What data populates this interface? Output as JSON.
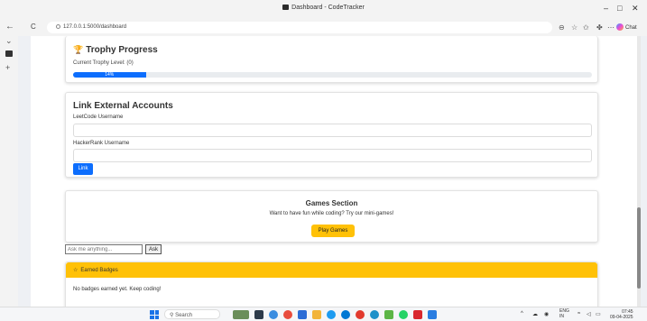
{
  "window": {
    "title": "Dashboard - CodeTracker",
    "minimize": "–",
    "maximize": "□",
    "close": "✕"
  },
  "browser": {
    "back": "←",
    "reload": "C",
    "url": "127.0.0.1:5000/dashboard",
    "chat_label": "Chat"
  },
  "trophy": {
    "title": "Trophy Progress",
    "current_level_text": "Current Trophy Level: (0)",
    "progress_label": "14%",
    "progress_fraction": 0.14
  },
  "link_accounts": {
    "title": "Link External Accounts",
    "leetcode_label": "LeetCode Username",
    "leetcode_value": "",
    "hackerrank_label": "HackerRank Username",
    "hackerrank_value": "",
    "button_label": "Link"
  },
  "games": {
    "title": "Games Section",
    "subtitle": "Want to have fun while coding? Try our mini-games!",
    "button_label": "Play Games"
  },
  "ask": {
    "placeholder": "Ask me anything...",
    "button_label": "Ask"
  },
  "badges": {
    "header": "Earned Badges",
    "body": "No badges earned yet. Keep coding!"
  },
  "taskbar": {
    "search_placeholder": "Search",
    "lang_line1": "ENG",
    "lang_line2": "IN",
    "time": "07:45",
    "date": "09-04-2025"
  },
  "colors": {
    "primary": "#0d6efd",
    "warning": "#ffc107"
  }
}
